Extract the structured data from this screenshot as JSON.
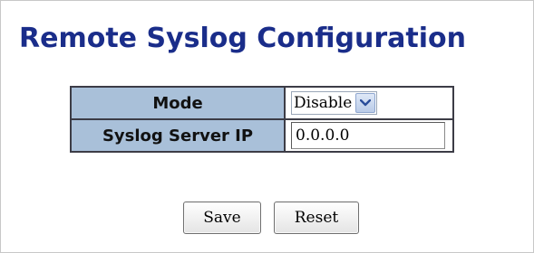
{
  "page": {
    "title": "Remote Syslog Configuration"
  },
  "config": {
    "mode_label": "Mode",
    "mode_value": "Disable",
    "mode_options": [
      "Disable"
    ],
    "server_ip_label": "Syslog Server IP",
    "server_ip_value": "0.0.0.0"
  },
  "buttons": {
    "save_label": "Save",
    "reset_label": "Reset"
  },
  "icons": {
    "dropdown": "chevron-down-icon"
  },
  "colors": {
    "title": "#1a2d8a",
    "header_cell": "#a9c0d9",
    "table_border": "#3c3c46"
  }
}
